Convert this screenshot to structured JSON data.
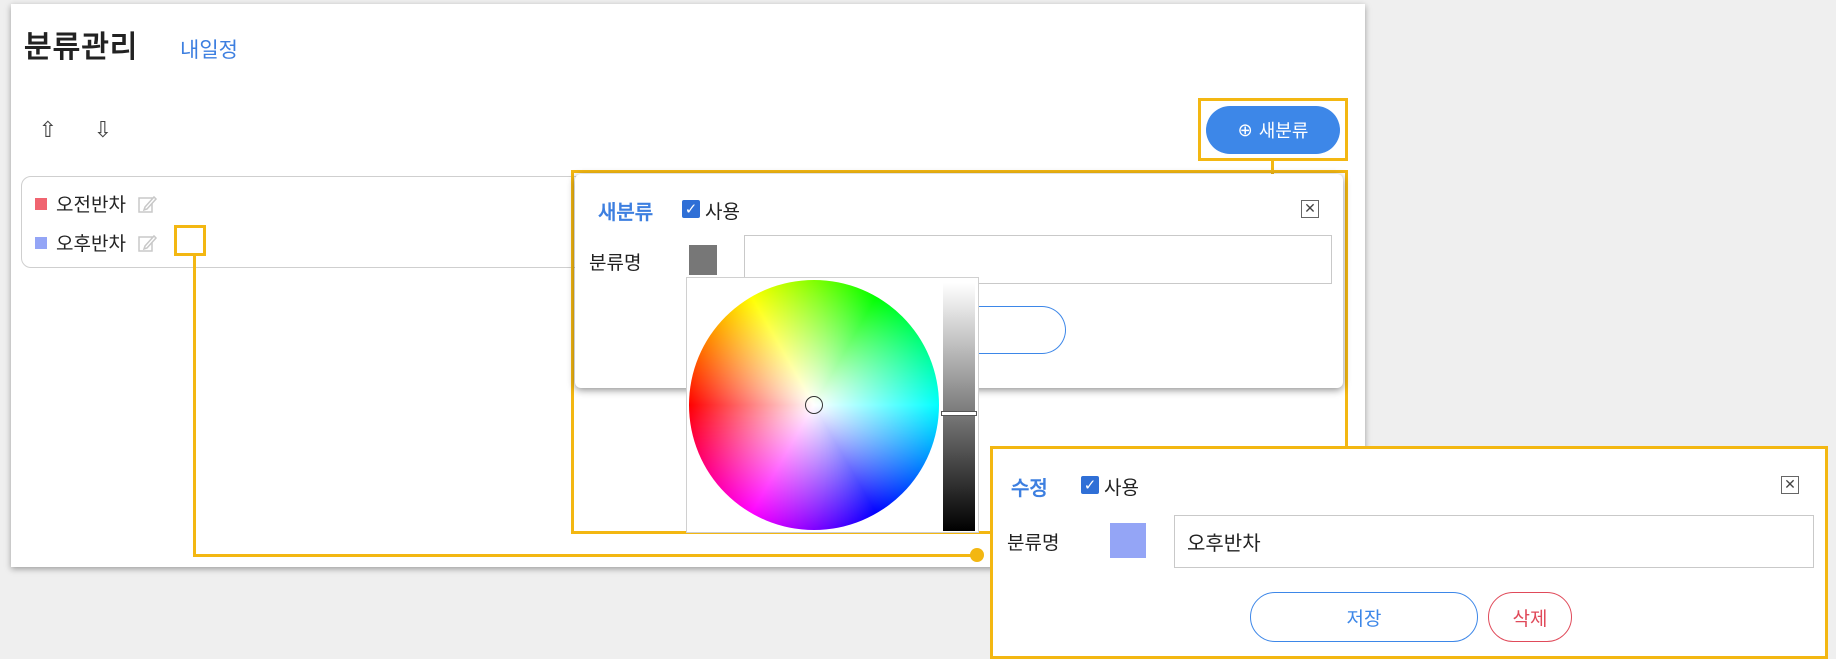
{
  "header": {
    "title": "분류관리",
    "subtitle": "내일정"
  },
  "toolbar": {
    "move_up_icon": "⇧",
    "move_down_icon": "⇩",
    "new_category_label": "새분류",
    "new_category_icon": "⊕"
  },
  "categories": [
    {
      "name": "오전반차",
      "color": "#f06470"
    },
    {
      "name": "오후반차",
      "color": "#94a5f6"
    }
  ],
  "new_dialog": {
    "title": "새분류",
    "use_label": "사용",
    "use_checked": true,
    "name_label": "분류명",
    "swatch_color": "#777777",
    "name_value": "",
    "close_icon": "✕",
    "check_mark": "✓"
  },
  "edit_dialog": {
    "title": "수정",
    "use_label": "사용",
    "use_checked": true,
    "name_label": "분류명",
    "swatch_color": "#94a5f6",
    "name_value": "오후반차",
    "save_label": "저장",
    "delete_label": "삭제",
    "close_icon": "✕",
    "check_mark": "✓"
  },
  "colors": {
    "accent": "#3d87e8",
    "highlight": "#f3b712",
    "danger": "#e04a5a"
  }
}
